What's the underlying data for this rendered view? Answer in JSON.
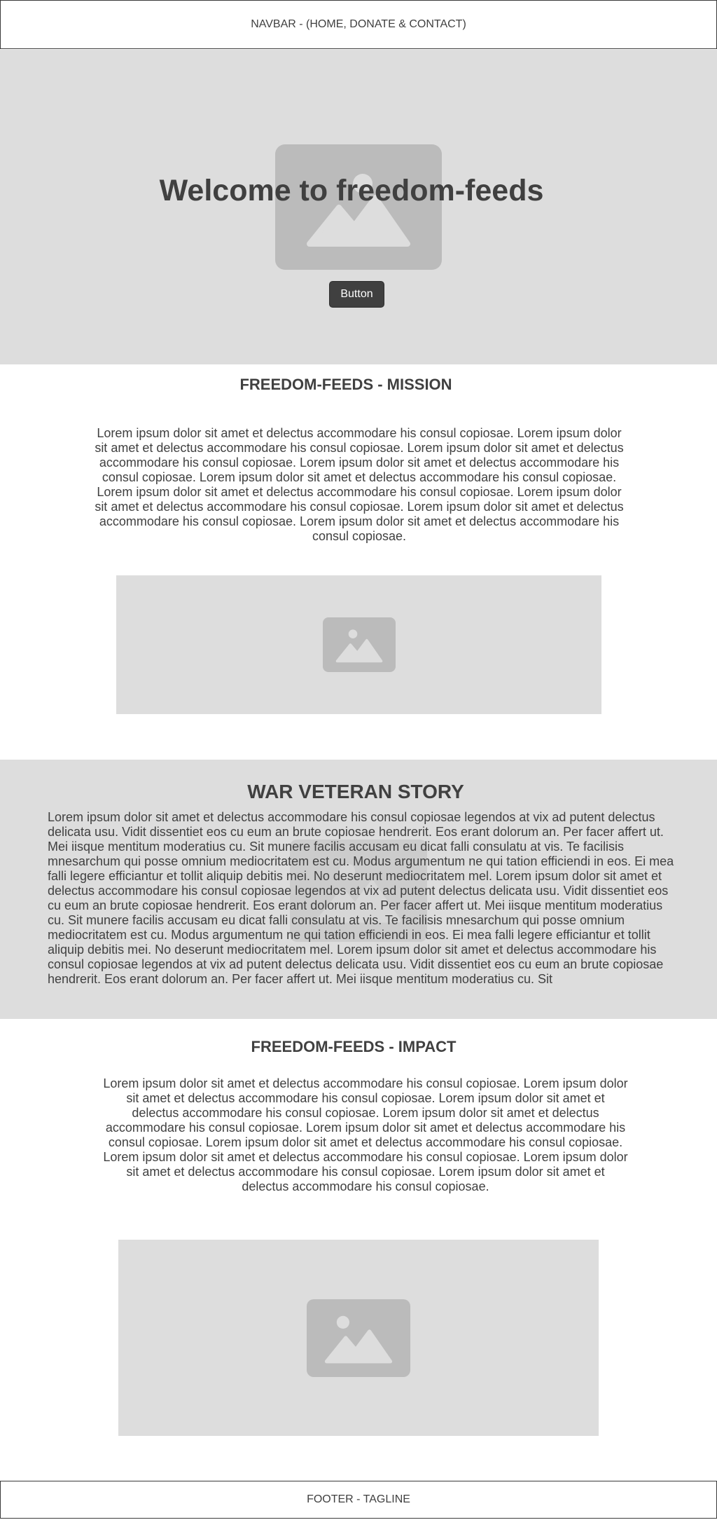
{
  "navbar": {
    "label": "NAVBAR - (HOME, DONATE & CONTACT)"
  },
  "hero": {
    "title": "Welcome to freedom-feeds",
    "button_label": "Button",
    "image_icon": "image-placeholder-icon"
  },
  "mission": {
    "title": "FREEDOM-FEEDS - MISSION",
    "body": "Lorem ipsum dolor sit amet et delectus accommodare his consul copiosae. Lorem ipsum dolor sit amet et delectus accommodare his consul copiosae. Lorem ipsum dolor sit amet et delectus accommodare his consul copiosae. Lorem ipsum dolor sit amet et delectus accommodare his consul copiosae. Lorem ipsum dolor sit amet et delectus accommodare his consul copiosae. Lorem ipsum dolor sit amet et delectus accommodare his consul copiosae. Lorem ipsum dolor sit amet et delectus accommodare his consul copiosae. Lorem ipsum dolor sit amet et delectus accommodare his consul copiosae. Lorem ipsum dolor sit amet et delectus accommodare his consul copiosae.",
    "image_icon": "image-placeholder-icon"
  },
  "story": {
    "title": "WAR VETERAN STORY",
    "body": "Lorem ipsum dolor sit amet et delectus accommodare his consul copiosae legendos at vix ad putent delectus delicata usu. Vidit dissentiet eos cu eum an brute copiosae hendrerit. Eos erant dolorum an. Per facer affert ut. Mei iisque mentitum moderatius cu. Sit munere facilis accusam eu dicat falli consulatu at vis. Te facilisis mnesarchum qui posse omnium mediocritatem est cu. Modus argumentum ne qui tation efficiendi in eos. Ei mea falli legere efficiantur et tollit aliquip debitis mei. No deserunt mediocritatem mel. Lorem ipsum dolor sit amet et delectus accommodare his consul copiosae legendos at vix ad putent delectus delicata usu. Vidit dissentiet eos cu eum an brute copiosae hendrerit. Eos erant dolorum an. Per facer affert ut. Mei iisque mentitum moderatius cu. Sit munere facilis accusam eu dicat falli consulatu at vis. Te facilisis mnesarchum qui posse omnium mediocritatem est cu. Modus argumentum ne qui tation efficiendi in eos. Ei mea falli legere efficiantur et tollit aliquip debitis mei. No deserunt mediocritatem mel. Lorem ipsum dolor sit amet et delectus accommodare his consul copiosae legendos at vix ad putent delectus delicata usu. Vidit dissentiet eos cu eum an brute copiosae hendrerit. Eos erant dolorum an. Per facer affert ut. Mei iisque mentitum moderatius cu. Sit"
  },
  "impact": {
    "title": "FREEDOM-FEEDS - IMPACT",
    "body": "Lorem ipsum dolor sit amet et delectus accommodare his consul copiosae. Lorem ipsum dolor sit amet et delectus accommodare his consul copiosae. Lorem ipsum dolor sit amet et delectus accommodare his consul copiosae. Lorem ipsum dolor sit amet et delectus accommodare his consul copiosae. Lorem ipsum dolor sit amet et delectus accommodare his consul copiosae. Lorem ipsum dolor sit amet et delectus accommodare his consul copiosae. Lorem ipsum dolor sit amet et delectus accommodare his consul copiosae. Lorem ipsum dolor sit amet et delectus accommodare his consul copiosae. Lorem ipsum dolor sit amet et delectus accommodare his consul copiosae.",
    "image_icon": "image-placeholder-icon"
  },
  "footer": {
    "label": "FOOTER - TAGLINE"
  },
  "colors": {
    "text": "#404040",
    "placeholder_bg": "#dddddd",
    "placeholder_icon": "#bbbbbb",
    "button_bg": "#404040"
  }
}
